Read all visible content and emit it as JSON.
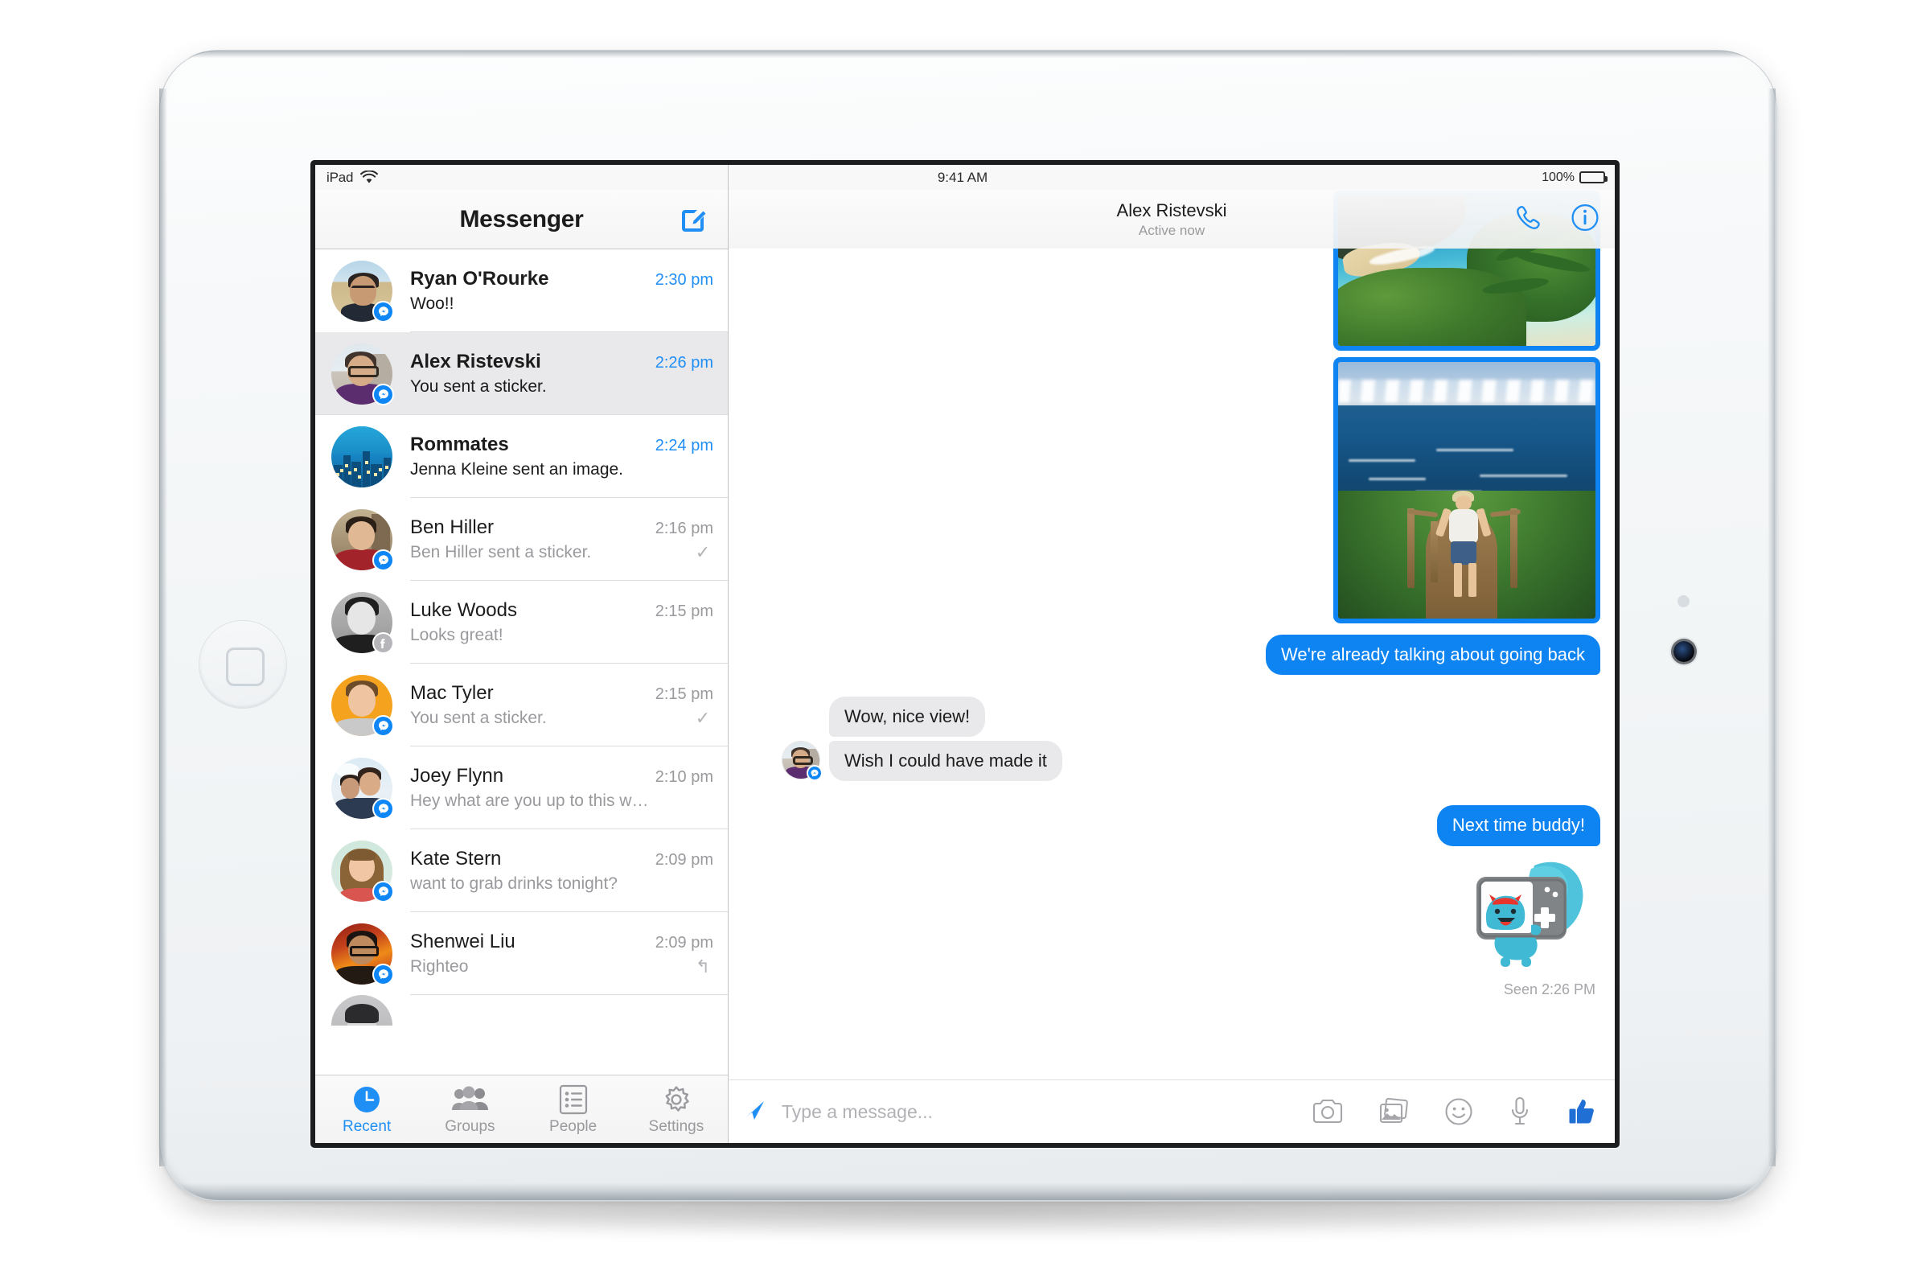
{
  "device": {
    "name": "iPad",
    "home_button": "home-button",
    "front_camera": "front-camera"
  },
  "status_bar": {
    "carrier_label": "iPad",
    "wifi_icon": "wifi-icon",
    "clock": "9:41 AM",
    "battery_percent": "100%",
    "battery_icon": "battery-full-icon"
  },
  "sidebar": {
    "title": "Messenger",
    "compose_icon": "compose-icon",
    "conversations": [
      {
        "name": "Ryan O'Rourke",
        "snippet": "Woo!!",
        "time": "2:30 pm",
        "unread": true,
        "badge": "messenger-badge",
        "status_icon": "",
        "avatar": "av-ryan"
      },
      {
        "name": "Alex Ristevski",
        "snippet": "You sent a sticker.",
        "time": "2:26 pm",
        "unread": true,
        "selected": true,
        "badge": "messenger-badge",
        "status_icon": "",
        "avatar": "av-alex"
      },
      {
        "name": "Rommates",
        "snippet": "Jenna Kleine sent an image.",
        "time": "2:24 pm",
        "unread": true,
        "badge": "",
        "status_icon": "",
        "avatar": "av-room"
      },
      {
        "name": "Ben Hiller",
        "snippet": "Ben Hiller sent a sticker.",
        "time": "2:16 pm",
        "unread": false,
        "badge": "messenger-badge",
        "status_icon": "✓",
        "avatar": "av-ben"
      },
      {
        "name": "Luke Woods",
        "snippet": "Looks great!",
        "time": "2:15 pm",
        "unread": false,
        "badge": "facebook-badge",
        "status_icon": "",
        "avatar": "av-luke"
      },
      {
        "name": "Mac Tyler",
        "snippet": "You sent a sticker.",
        "time": "2:15 pm",
        "unread": false,
        "badge": "messenger-badge",
        "status_icon": "✓",
        "avatar": "av-mac"
      },
      {
        "name": "Joey Flynn",
        "snippet": "Hey what are you up to this w…",
        "time": "2:10 pm",
        "unread": false,
        "badge": "messenger-badge",
        "status_icon": "",
        "avatar": "av-joey"
      },
      {
        "name": "Kate Stern",
        "snippet": "want to grab drinks tonight?",
        "time": "2:09 pm",
        "unread": false,
        "badge": "messenger-badge",
        "status_icon": "",
        "avatar": "av-kate"
      },
      {
        "name": "Shenwei Liu",
        "snippet": "Righteo",
        "time": "2:09 pm",
        "unread": false,
        "badge": "messenger-badge",
        "status_icon": "↰",
        "avatar": "av-shen"
      }
    ],
    "tabs": [
      {
        "label": "Recent",
        "icon": "clock-icon",
        "active": true
      },
      {
        "label": "Groups",
        "icon": "people-group-icon",
        "active": false
      },
      {
        "label": "People",
        "icon": "list-icon",
        "active": false
      },
      {
        "label": "Settings",
        "icon": "gear-icon",
        "active": false
      }
    ]
  },
  "thread": {
    "contact_name": "Alex Ristevski",
    "presence": "Active now",
    "call_icon": "phone-icon",
    "info_icon": "info-icon",
    "messages": [
      {
        "type": "photo",
        "direction": "out",
        "alt": "Tropical beach cove from a cliff overlook"
      },
      {
        "type": "photo",
        "direction": "out",
        "alt": "Woman on a coastal hiking trail above the ocean"
      },
      {
        "type": "text",
        "direction": "out",
        "text": "We're already talking about going back"
      },
      {
        "type": "text",
        "direction": "in",
        "text": "Wow, nice view!"
      },
      {
        "type": "text",
        "direction": "in",
        "text": "Wish I could have made it"
      },
      {
        "type": "text",
        "direction": "out",
        "text": "Next time buddy!"
      },
      {
        "type": "sticker",
        "direction": "out",
        "alt": "Blue monster holding a handheld game console taking a selfie"
      }
    ],
    "seen_receipt": "Seen 2:26 PM"
  },
  "composer": {
    "send_icon": "send-arrow-icon",
    "placeholder": "Type a message...",
    "value": "",
    "actions": [
      {
        "icon": "camera-icon",
        "name": "camera-button"
      },
      {
        "icon": "photos-icon",
        "name": "photos-button"
      },
      {
        "icon": "sticker-face-icon",
        "name": "stickers-button"
      },
      {
        "icon": "microphone-icon",
        "name": "voice-button"
      },
      {
        "icon": "thumbs-up-icon",
        "name": "like-button"
      }
    ]
  },
  "colors": {
    "messenger_blue": "#0d84f2",
    "accent_blue": "#1f8ef5",
    "incoming_bubble": "#e9e9eb",
    "muted_text": "#9a9a9e",
    "selected_row": "#e9e9eb"
  }
}
